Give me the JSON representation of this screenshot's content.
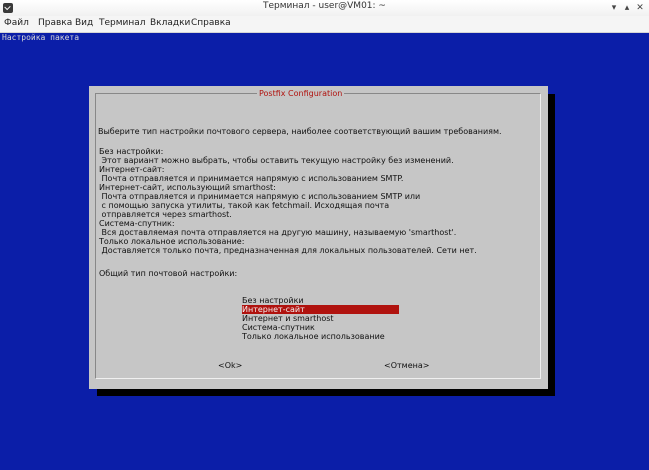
{
  "window": {
    "title": "Терминал - user@VM01: ~"
  },
  "menu": [
    "Файл",
    "Правка",
    "Вид",
    "Терминал",
    "Вкладки",
    "Справка"
  ],
  "terminal": {
    "top_text": "Настройка пакета"
  },
  "dialog": {
    "title": "Postfix Configuration",
    "lines": [
      "Выберите тип настройки почтового сервера, наиболее соответствующий вашим требованиям.",
      "",
      "Без настройки:",
      " Этот вариант можно выбрать, чтобы оставить текущую настройку без изменений.",
      "Интернет-сайт:",
      " Почта отправляется и принимается напрямую с использованием SMTP.",
      "Интернет-сайт, использующий smarthost:",
      " Почта отправляется и принимается напрямую с использованием SMTP или",
      " с помощью запуска утилиты, такой как fetchmail. Исходящая почта",
      " отправляется через smarthost.",
      "Система-спутник:",
      " Вся доставляемая почта отправляется на другую машину, называемую 'smarthost'.",
      "Только локальное использование:",
      " Доставляется только почта, предназначенная для локальных пользователей. Сети нет.",
      "",
      "Общий тип почтовой настройки:"
    ],
    "options": [
      "Без настройки",
      "Интернет-сайт",
      "Интернет и smarthost",
      "Система-спутник",
      "Только локальное использование"
    ],
    "selected_option": "Интернет-сайт",
    "ok_button": "<Ok>",
    "cancel_button": "<Отмена>"
  }
}
